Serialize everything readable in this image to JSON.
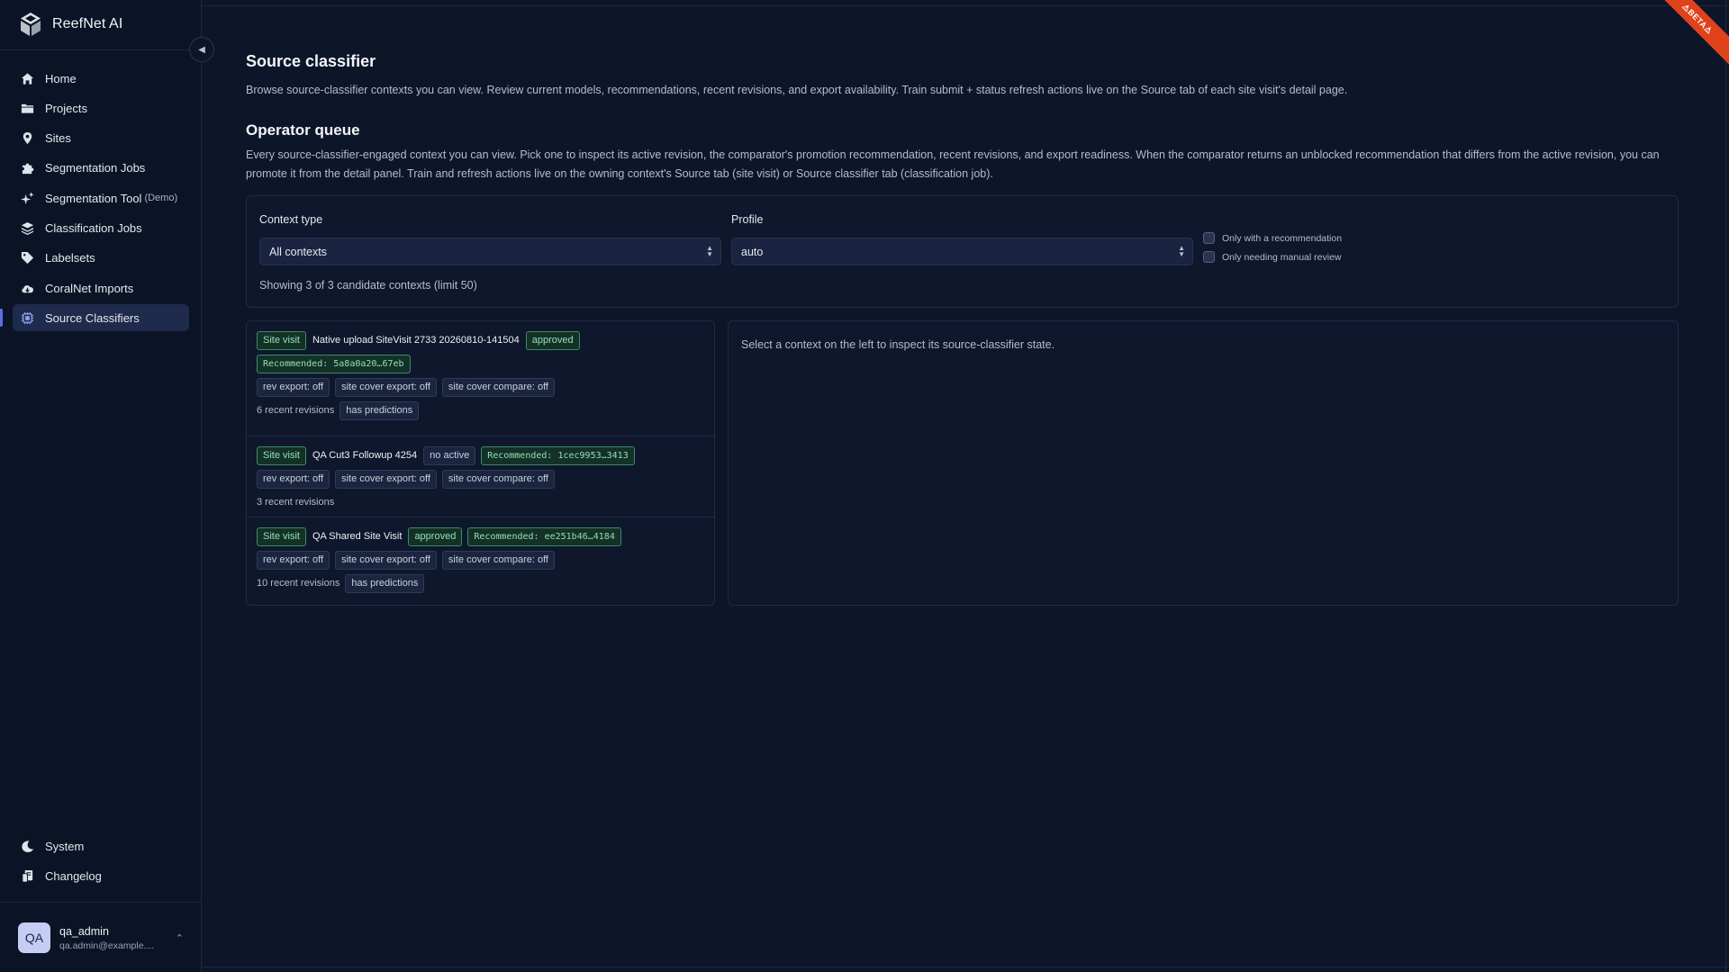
{
  "app": {
    "name": "ReefNet AI",
    "beta": "BETA"
  },
  "sidebar": {
    "items": [
      {
        "label": "Home",
        "icon": "home-icon"
      },
      {
        "label": "Projects",
        "icon": "folder-icon"
      },
      {
        "label": "Sites",
        "icon": "map-pin-icon"
      },
      {
        "label": "Segmentation Jobs",
        "icon": "puzzle-icon"
      },
      {
        "label": "Segmentation Tool",
        "suffix": "(Demo)",
        "icon": "sparkles-icon"
      },
      {
        "label": "Classification Jobs",
        "icon": "layers-icon"
      },
      {
        "label": "Labelsets",
        "icon": "tag-icon"
      },
      {
        "label": "CoralNet Imports",
        "icon": "cloud-download-icon"
      },
      {
        "label": "Source Classifiers",
        "icon": "chip-icon",
        "active": true
      }
    ],
    "bottom": [
      {
        "label": "System",
        "icon": "moon-icon"
      },
      {
        "label": "Changelog",
        "icon": "changelog-icon"
      }
    ],
    "user": {
      "initials": "QA",
      "name": "qa_admin",
      "email": "qa.admin@example...."
    }
  },
  "page": {
    "title": "Source classifier",
    "subtitle": "Browse source-classifier contexts you can view. Review current models, recommendations, recent revisions, and export availability. Train submit + status refresh actions live on the Source tab of each site visit's detail page.",
    "section_title": "Operator queue",
    "section_desc": "Every source-classifier-engaged context you can view. Pick one to inspect its active revision, the comparator's promotion recommendation, recent revisions, and export readiness. When the comparator returns an unblocked recommendation that differs from the active revision, you can promote it from the detail panel. Train and refresh actions live on the owning context's Source tab (site visit) or Source classifier tab (classification job)."
  },
  "filters": {
    "context_type_label": "Context type",
    "context_type_value": "All contexts",
    "profile_label": "Profile",
    "profile_value": "auto",
    "check_recommendation": "Only with a recommendation",
    "check_manual": "Only needing manual review",
    "showing": "Showing 3 of 3 candidate contexts (limit 50)"
  },
  "contexts": [
    {
      "type": "Site visit",
      "name": "Native upload SiteVisit 2733 20260810-141504",
      "status": "approved",
      "recommended": "Recommended: 5a8a0a20…67eb",
      "rev_export": "rev export: off",
      "site_cover_export": "site cover export: off",
      "site_cover_compare": "site cover compare: off",
      "revisions": "6 recent revisions",
      "predictions": "has predictions"
    },
    {
      "type": "Site visit",
      "name": "QA Cut3 Followup 4254",
      "status": "no active",
      "recommended": "Recommended: 1cec9953…3413",
      "rev_export": "rev export: off",
      "site_cover_export": "site cover export: off",
      "site_cover_compare": "site cover compare: off",
      "revisions": "3 recent revisions"
    },
    {
      "type": "Site visit",
      "name": "QA Shared Site Visit",
      "status": "approved",
      "recommended": "Recommended: ee251b46…4184",
      "rev_export": "rev export: off",
      "site_cover_export": "site cover export: off",
      "site_cover_compare": "site cover compare: off",
      "revisions": "10 recent revisions",
      "predictions": "has predictions"
    }
  ],
  "detail": {
    "empty_message": "Select a context on the left to inspect its source-classifier state."
  }
}
